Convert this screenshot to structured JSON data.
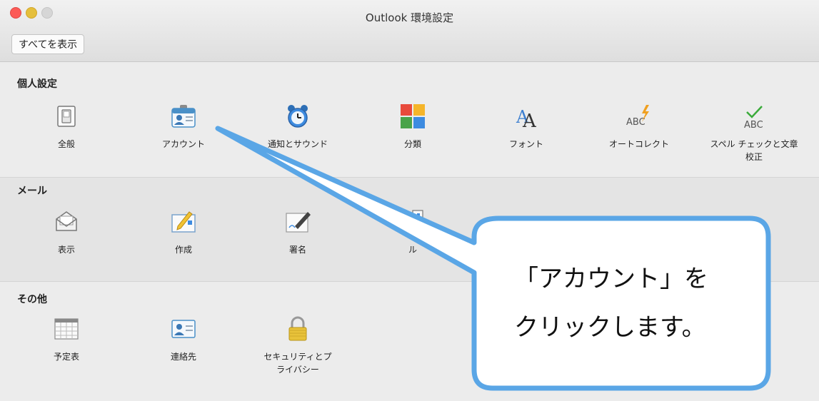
{
  "window": {
    "title": "Outlook 環境設定",
    "show_all_label": "すべてを表示"
  },
  "sections": {
    "personal": {
      "title": "個人設定",
      "items": [
        {
          "label": "全般",
          "icon": "switch-icon"
        },
        {
          "label": "アカウント",
          "icon": "account-card-icon"
        },
        {
          "label": "通知とサウンド",
          "icon": "alarm-clock-icon"
        },
        {
          "label": "分類",
          "icon": "category-squares-icon"
        },
        {
          "label": "フォント",
          "icon": "font-icon"
        },
        {
          "label": "オートコレクト",
          "icon": "autocorrect-icon"
        },
        {
          "label": "スペル チェックと文章校正",
          "icon": "spell-check-icon"
        }
      ]
    },
    "mail": {
      "title": "メール",
      "items": [
        {
          "label": "表示",
          "icon": "envelope-icon"
        },
        {
          "label": "作成",
          "icon": "compose-icon"
        },
        {
          "label": "署名",
          "icon": "signature-pen-icon"
        },
        {
          "label": "ル",
          "icon": "rules-icon"
        }
      ]
    },
    "other": {
      "title": "その他",
      "items": [
        {
          "label": "予定表",
          "icon": "calendar-grid-icon"
        },
        {
          "label": "連絡先",
          "icon": "contact-card-icon"
        },
        {
          "label": "セキュリティとプライバシー",
          "icon": "padlock-icon"
        }
      ]
    }
  },
  "callout": {
    "line1": "「アカウント」を",
    "line2": "クリックします。"
  },
  "colors": {
    "callout_border": "#5aa6e6",
    "callout_fill": "#ffffff"
  }
}
